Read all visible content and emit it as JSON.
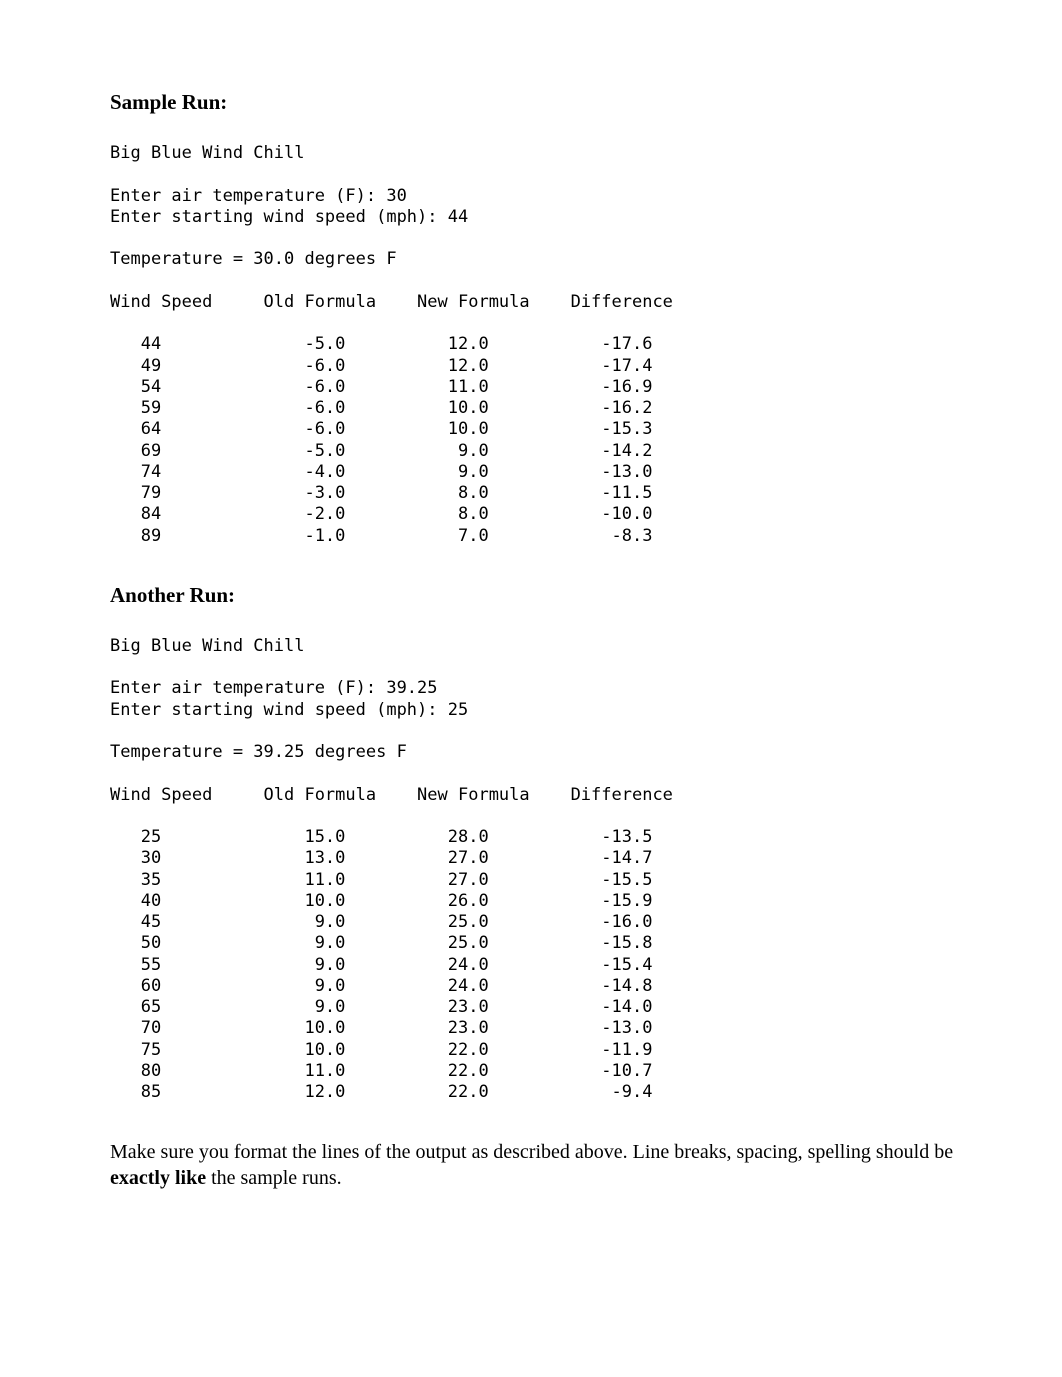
{
  "heading1": "Sample Run:",
  "run1": {
    "title": "Big Blue Wind Chill",
    "prompt_temp": "Enter air temperature (F): 30",
    "prompt_speed": "Enter starting wind speed (mph): 44",
    "temp_line": "Temperature = 30.0 degrees F",
    "headers": [
      "Wind Speed",
      "Old Formula",
      "New Formula",
      "Difference"
    ],
    "rows": [
      {
        "ws": "44",
        "old": "-5.0",
        "new": "12.0",
        "diff": "-17.6"
      },
      {
        "ws": "49",
        "old": "-6.0",
        "new": "12.0",
        "diff": "-17.4"
      },
      {
        "ws": "54",
        "old": "-6.0",
        "new": "11.0",
        "diff": "-16.9"
      },
      {
        "ws": "59",
        "old": "-6.0",
        "new": "10.0",
        "diff": "-16.2"
      },
      {
        "ws": "64",
        "old": "-6.0",
        "new": "10.0",
        "diff": "-15.3"
      },
      {
        "ws": "69",
        "old": "-5.0",
        "new": "9.0",
        "diff": "-14.2"
      },
      {
        "ws": "74",
        "old": "-4.0",
        "new": "9.0",
        "diff": "-13.0"
      },
      {
        "ws": "79",
        "old": "-3.0",
        "new": "8.0",
        "diff": "-11.5"
      },
      {
        "ws": "84",
        "old": "-2.0",
        "new": "8.0",
        "diff": "-10.0"
      },
      {
        "ws": "89",
        "old": "-1.0",
        "new": "7.0",
        "diff": "-8.3"
      }
    ]
  },
  "heading2": "Another Run:",
  "run2": {
    "title": "Big Blue Wind Chill",
    "prompt_temp": "Enter air temperature (F): 39.25",
    "prompt_speed": "Enter starting wind speed (mph): 25",
    "temp_line": "Temperature = 39.25 degrees F",
    "headers": [
      "Wind Speed",
      "Old Formula",
      "New Formula",
      "Difference"
    ],
    "rows": [
      {
        "ws": "25",
        "old": "15.0",
        "new": "28.0",
        "diff": "-13.5"
      },
      {
        "ws": "30",
        "old": "13.0",
        "new": "27.0",
        "diff": "-14.7"
      },
      {
        "ws": "35",
        "old": "11.0",
        "new": "27.0",
        "diff": "-15.5"
      },
      {
        "ws": "40",
        "old": "10.0",
        "new": "26.0",
        "diff": "-15.9"
      },
      {
        "ws": "45",
        "old": "9.0",
        "new": "25.0",
        "diff": "-16.0"
      },
      {
        "ws": "50",
        "old": "9.0",
        "new": "25.0",
        "diff": "-15.8"
      },
      {
        "ws": "55",
        "old": "9.0",
        "new": "24.0",
        "diff": "-15.4"
      },
      {
        "ws": "60",
        "old": "9.0",
        "new": "24.0",
        "diff": "-14.8"
      },
      {
        "ws": "65",
        "old": "9.0",
        "new": "23.0",
        "diff": "-14.0"
      },
      {
        "ws": "70",
        "old": "10.0",
        "new": "23.0",
        "diff": "-13.0"
      },
      {
        "ws": "75",
        "old": "10.0",
        "new": "22.0",
        "diff": "-11.9"
      },
      {
        "ws": "80",
        "old": "11.0",
        "new": "22.0",
        "diff": "-10.7"
      },
      {
        "ws": "85",
        "old": "12.0",
        "new": "22.0",
        "diff": "-9.4"
      }
    ]
  },
  "footer_pre": "Make sure you format the lines of the output as described above. Line breaks, spacing, spelling should be ",
  "footer_bold": "exactly like",
  "footer_post": " the sample runs."
}
